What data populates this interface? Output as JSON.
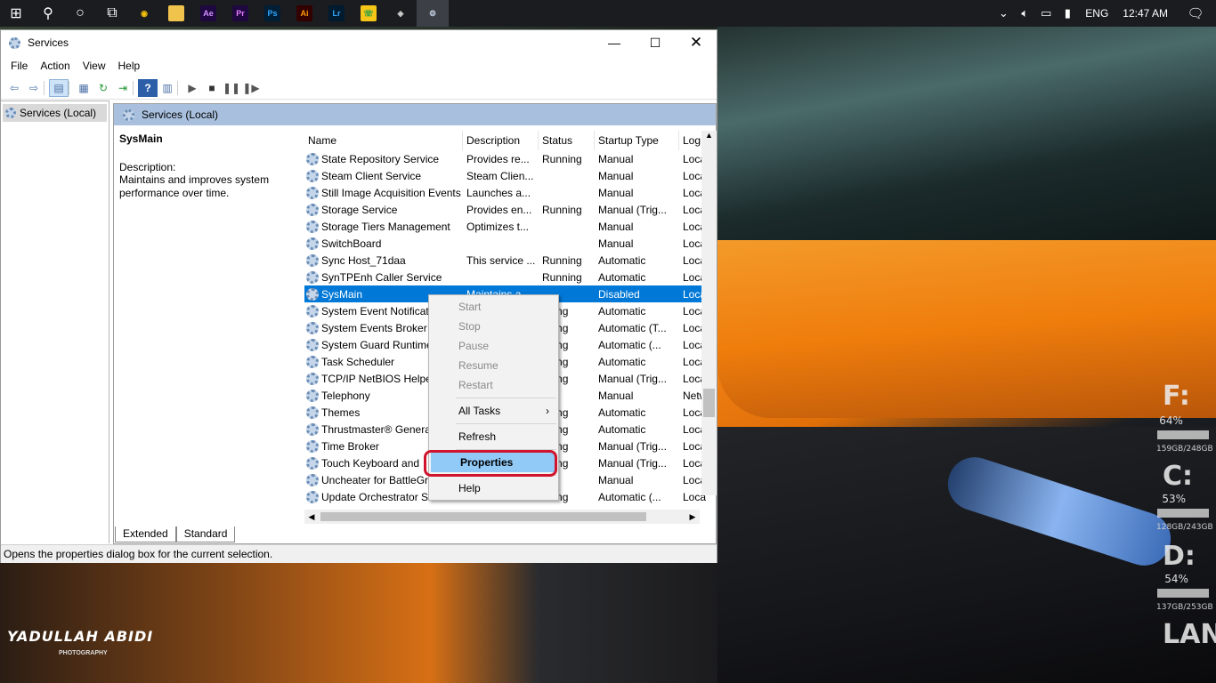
{
  "taskbar": {
    "apps": [
      {
        "name": "chrome",
        "glyph": "◉",
        "bg": "#1b1c20",
        "fg": "#f4c20d"
      },
      {
        "name": "file-explorer",
        "glyph": "▬",
        "bg": "#f0c44c",
        "fg": "#f0c44c"
      },
      {
        "name": "after-effects",
        "glyph": "Ae",
        "bg": "#1f0740",
        "fg": "#d291ff"
      },
      {
        "name": "premiere",
        "glyph": "Pr",
        "bg": "#1f0740",
        "fg": "#e77cff"
      },
      {
        "name": "photoshop",
        "glyph": "Ps",
        "bg": "#001e36",
        "fg": "#31a8ff"
      },
      {
        "name": "illustrator",
        "glyph": "Ai",
        "bg": "#330000",
        "fg": "#ff9a00"
      },
      {
        "name": "lightroom",
        "glyph": "Lr",
        "bg": "#001a2f",
        "fg": "#31a8ff"
      },
      {
        "name": "whatsapp",
        "glyph": "☏",
        "bg": "#f5c518",
        "fg": "#1b9c4a"
      },
      {
        "name": "game-app",
        "glyph": "◈",
        "bg": "#1b1c20",
        "fg": "#d0d0d0"
      },
      {
        "name": "services",
        "glyph": "⚙",
        "bg": "#3d3f46",
        "fg": "#c9d6e8"
      }
    ],
    "tray": {
      "lang": "ENG",
      "time": "12:47 AM"
    }
  },
  "window": {
    "title": "Services",
    "menu": [
      "File",
      "Action",
      "View",
      "Help"
    ],
    "tree_item": "Services (Local)",
    "pane_title": "Services (Local)",
    "ext": {
      "title": "SysMain",
      "desc_label": "Description:",
      "desc": "Maintains and improves system performance over time."
    },
    "columns": [
      "Name",
      "Description",
      "Status",
      "Startup Type",
      "Log"
    ],
    "rows": [
      {
        "name": "State Repository Service",
        "desc": "Provides re...",
        "status": "Running",
        "start": "Manual",
        "log": "Loca"
      },
      {
        "name": "Steam Client Service",
        "desc": "Steam Clien...",
        "status": "",
        "start": "Manual",
        "log": "Loca"
      },
      {
        "name": "Still Image Acquisition Events",
        "desc": "Launches a...",
        "status": "",
        "start": "Manual",
        "log": "Loca"
      },
      {
        "name": "Storage Service",
        "desc": "Provides en...",
        "status": "Running",
        "start": "Manual (Trig...",
        "log": "Loca"
      },
      {
        "name": "Storage Tiers Management",
        "desc": "Optimizes t...",
        "status": "",
        "start": "Manual",
        "log": "Loca"
      },
      {
        "name": "SwitchBoard",
        "desc": "",
        "status": "",
        "start": "Manual",
        "log": "Loca"
      },
      {
        "name": "Sync Host_71daa",
        "desc": "This service ...",
        "status": "Running",
        "start": "Automatic",
        "log": "Loca"
      },
      {
        "name": "SynTPEnh Caller Service",
        "desc": "",
        "status": "Running",
        "start": "Automatic",
        "log": "Loca"
      },
      {
        "name": "SysMain",
        "desc": "Maintains a...",
        "status": "",
        "start": "Disabled",
        "log": "Loca"
      },
      {
        "name": "System Event Notificati",
        "desc": "",
        "status": "nning",
        "start": "Automatic",
        "log": "Loca"
      },
      {
        "name": "System Events Broker",
        "desc": "",
        "status": "nning",
        "start": "Automatic (T...",
        "log": "Loca"
      },
      {
        "name": "System Guard Runtime",
        "desc": "",
        "status": "nning",
        "start": "Automatic (...",
        "log": "Loca"
      },
      {
        "name": "Task Scheduler",
        "desc": "",
        "status": "nning",
        "start": "Automatic",
        "log": "Loca"
      },
      {
        "name": "TCP/IP NetBIOS Helper",
        "desc": "",
        "status": "nning",
        "start": "Manual (Trig...",
        "log": "Loca"
      },
      {
        "name": "Telephony",
        "desc": "",
        "status": "",
        "start": "Manual",
        "log": "Netw"
      },
      {
        "name": "Themes",
        "desc": "",
        "status": "nning",
        "start": "Automatic",
        "log": "Loca"
      },
      {
        "name": "Thrustmaster® Genera",
        "desc": "",
        "status": "nning",
        "start": "Automatic",
        "log": "Loca"
      },
      {
        "name": "Time Broker",
        "desc": "",
        "status": "nning",
        "start": "Manual (Trig...",
        "log": "Loca"
      },
      {
        "name": "Touch Keyboard and",
        "desc": "",
        "status": "nning",
        "start": "Manual (Trig...",
        "log": "Loca"
      },
      {
        "name": "Uncheater for BattleGr",
        "desc": "",
        "status": "",
        "start": "Manual",
        "log": "Loca"
      },
      {
        "name": "Update Orchestrator Se",
        "desc": "",
        "status": "nning",
        "start": "Automatic (...",
        "log": "Loca"
      }
    ],
    "selected_index": 8,
    "tabs": [
      "Extended",
      "Standard"
    ],
    "status": "Opens the properties dialog box for the current selection."
  },
  "context_menu": {
    "items": [
      {
        "label": "Start",
        "disabled": true
      },
      {
        "label": "Stop",
        "disabled": true
      },
      {
        "label": "Pause",
        "disabled": true
      },
      {
        "label": "Resume",
        "disabled": true
      },
      {
        "label": "Restart",
        "disabled": true
      },
      {
        "sep": true
      },
      {
        "label": "All Tasks",
        "submenu": true
      },
      {
        "sep": true
      },
      {
        "label": "Refresh"
      },
      {
        "sep": true
      },
      {
        "label": "Properties",
        "highlighted": true
      },
      {
        "sep": true
      },
      {
        "label": "Help"
      }
    ]
  },
  "desktop": {
    "watermark": "YADULLAH ABIDI",
    "watermark_sub": "PHOTOGRAPHY",
    "drives": [
      {
        "letter": "F:",
        "pct": "64%",
        "size": "159GB/248GB"
      },
      {
        "letter": "C:",
        "pct": "53%",
        "size": "128GB/243GB"
      },
      {
        "letter": "D:",
        "pct": "54%",
        "size": "137GB/253GB"
      }
    ],
    "lan": "LAN"
  }
}
